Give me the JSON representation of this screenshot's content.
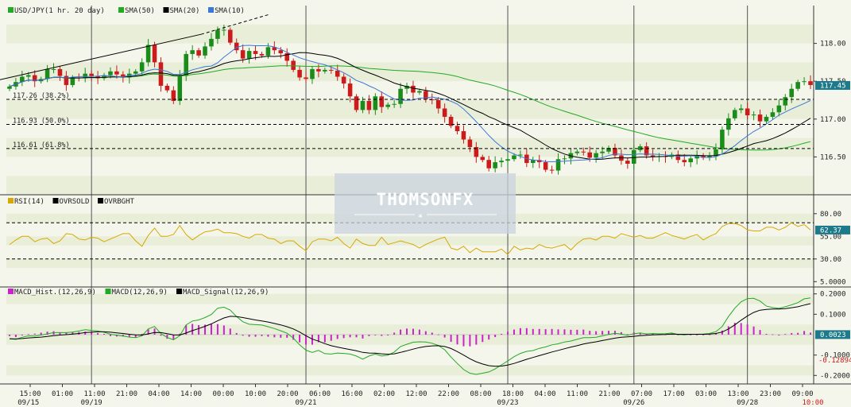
{
  "chart_data": [
    {
      "type": "candlestick",
      "panel": "price",
      "legend": [
        {
          "label": "USD/JPY(1 hr.  20 day)",
          "color": "#22aa22"
        },
        {
          "label": "SMA(50)",
          "color": "#22aa22"
        },
        {
          "label": "SMA(20)",
          "color": "#000000"
        },
        {
          "label": "SMA(10)",
          "color": "#3a78d8"
        }
      ],
      "y_ticks": [
        "118.00",
        "117.50",
        "117.00",
        "116.50"
      ],
      "ylim": [
        116.0,
        118.5
      ],
      "last_price": "117.45",
      "fib_levels": [
        {
          "label": "117.26 (38.2%)",
          "value": 117.26
        },
        {
          "label": "116.93 (50.0%)",
          "value": 116.93
        },
        {
          "label": "116.61 (61.8%)",
          "value": 116.61
        }
      ],
      "close_series": [
        117.43,
        117.49,
        117.56,
        117.58,
        117.5,
        117.53,
        117.66,
        117.66,
        117.57,
        117.45,
        117.55,
        117.54,
        117.6,
        117.57,
        117.54,
        117.58,
        117.63,
        117.59,
        117.55,
        117.6,
        117.63,
        117.75,
        117.98,
        117.75,
        117.44,
        117.38,
        117.24,
        117.57,
        117.86,
        117.91,
        117.84,
        117.96,
        118.06,
        118.18,
        118.18,
        118.01,
        117.91,
        117.8,
        117.9,
        117.86,
        117.84,
        117.95,
        117.91,
        117.87,
        117.77,
        117.65,
        117.55,
        117.53,
        117.66,
        117.63,
        117.65,
        117.64,
        117.56,
        117.47,
        117.3,
        117.12,
        117.24,
        117.12,
        117.3,
        117.16,
        117.19,
        117.2,
        117.4,
        117.44,
        117.35,
        117.37,
        117.26,
        117.25,
        117.14,
        117.03,
        116.91,
        116.84,
        116.73,
        116.63,
        116.5,
        116.46,
        116.35,
        116.43,
        116.45,
        116.47,
        116.52,
        116.53,
        116.42,
        116.46,
        116.43,
        116.33,
        116.32,
        116.47,
        116.48,
        116.55,
        116.57,
        116.56,
        116.49,
        116.55,
        116.57,
        116.62,
        116.52,
        116.45,
        116.41,
        116.59,
        116.64,
        116.52,
        116.5,
        116.51,
        116.5,
        116.53,
        116.46,
        116.43,
        116.48,
        116.52,
        116.49,
        116.51,
        116.6,
        116.86,
        117.01,
        117.12,
        117.14,
        117.05,
        117.06,
        116.97,
        117.03,
        117.09,
        117.18,
        117.29,
        117.4,
        117.49,
        117.5,
        117.45
      ],
      "x_ticks": [
        "15:00",
        "01:00",
        "11:00",
        "21:00",
        "04:00",
        "14:00",
        "00:00",
        "10:00",
        "20:00",
        "06:00",
        "16:00",
        "02:00",
        "12:00",
        "22:00",
        "08:00",
        "18:00",
        "04:00",
        "11:00",
        "21:00",
        "07:00",
        "17:00",
        "03:00",
        "13:00",
        "23:00",
        "09:00"
      ],
      "x_tick_dates": [
        "09/15",
        "",
        "",
        "",
        "",
        "",
        "09/19",
        "",
        "",
        "",
        "",
        "09/21",
        "",
        "",
        "",
        "",
        "09/23",
        "",
        "09/26",
        "",
        "",
        "",
        "",
        "09/28",
        ""
      ],
      "session_markers": [
        "09/15",
        "09/19",
        "09/21",
        "09/23",
        "09/26",
        "09/28"
      ]
    },
    {
      "type": "line",
      "panel": "rsi",
      "legend": [
        {
          "label": "RSI(14)",
          "color": "#d8a800"
        },
        {
          "label": "OVRSOLD",
          "color": "#000000"
        },
        {
          "label": "OVRBGHT",
          "color": "#000000"
        }
      ],
      "y_ticks": [
        "80.00",
        "30.00",
        "5.0000"
      ],
      "ylim": [
        0,
        100
      ],
      "overbought": 70,
      "oversold": 30,
      "last_value": "62.37",
      "behind_label": "55.00",
      "values": [
        46,
        51,
        55,
        55,
        49,
        52,
        53,
        47,
        50,
        58,
        57,
        52,
        51,
        54,
        53,
        49,
        52,
        55,
        58,
        58,
        50,
        44,
        56,
        64,
        55,
        55,
        57,
        67,
        57,
        51,
        56,
        60,
        61,
        63,
        59,
        59,
        58,
        55,
        53,
        57,
        57,
        53,
        52,
        47,
        50,
        50,
        44,
        39,
        49,
        52,
        52,
        50,
        54,
        47,
        42,
        52,
        47,
        45,
        45,
        54,
        46,
        48,
        50,
        48,
        46,
        42,
        46,
        49,
        52,
        54,
        42,
        40,
        44,
        37,
        42,
        38,
        38,
        38,
        41,
        35,
        44,
        40,
        42,
        41,
        46,
        43,
        42,
        44,
        46,
        40,
        47,
        52,
        53,
        51,
        55,
        55,
        53,
        58,
        56,
        54,
        56,
        53,
        53,
        56,
        59,
        56,
        54,
        52,
        55,
        57,
        51,
        55,
        58,
        66,
        69,
        69,
        67,
        62,
        61,
        61,
        65,
        65,
        62,
        65,
        70,
        66,
        68,
        62
      ]
    },
    {
      "type": "bar+line",
      "panel": "macd",
      "legend": [
        {
          "label": "MACD_Hist.(12,26,9)",
          "color": "#cc22cc"
        },
        {
          "label": "MACD(12,26,9)",
          "color": "#22aa22"
        },
        {
          "label": "MACD_Signal(12,26,9)",
          "color": "#000000"
        }
      ],
      "y_ticks": [
        "0.2000",
        "0.1000",
        "-0.1000",
        "-0.2000"
      ],
      "ylim": [
        -0.23,
        0.23
      ],
      "last_value": "0.0023",
      "low_label": "-0.12894",
      "macd": [
        -0.02,
        -0.023,
        -0.013,
        -0.006,
        -0.007,
        -0.002,
        0.004,
        0.01,
        0.01,
        0.01,
        0.013,
        0.018,
        0.024,
        0.021,
        0.018,
        0.012,
        0.002,
        -0.003,
        -0.007,
        -0.012,
        -0.015,
        -0.006,
        0.028,
        0.04,
        0.005,
        -0.014,
        -0.025,
        -0.005,
        0.048,
        0.067,
        0.072,
        0.084,
        0.099,
        0.13,
        0.135,
        0.12,
        0.089,
        0.063,
        0.051,
        0.049,
        0.047,
        0.039,
        0.03,
        0.019,
        0.007,
        -0.017,
        -0.05,
        -0.076,
        -0.087,
        -0.077,
        -0.093,
        -0.095,
        -0.09,
        -0.092,
        -0.095,
        -0.105,
        -0.12,
        -0.105,
        -0.095,
        -0.105,
        -0.101,
        -0.085,
        -0.058,
        -0.047,
        -0.037,
        -0.035,
        -0.036,
        -0.042,
        -0.053,
        -0.074,
        -0.11,
        -0.141,
        -0.171,
        -0.189,
        -0.195,
        -0.189,
        -0.183,
        -0.168,
        -0.148,
        -0.129,
        -0.108,
        -0.092,
        -0.082,
        -0.078,
        -0.067,
        -0.06,
        -0.05,
        -0.045,
        -0.036,
        -0.031,
        -0.023,
        -0.015,
        -0.015,
        -0.013,
        -0.006,
        0.001,
        0.007,
        0.003,
        -0.003,
        0.005,
        0.008,
        0.004,
        0.006,
        0.004,
        0.005,
        0.008,
        0.001,
        -0.001,
        0.002,
        0.002,
        0.003,
        0.006,
        0.015,
        0.04,
        0.089,
        0.13,
        0.161,
        0.177,
        0.178,
        0.165,
        0.14,
        0.133,
        0.129,
        0.137,
        0.146,
        0.157,
        0.176,
        0.18
      ],
      "signal": [
        -0.02,
        -0.021,
        -0.019,
        -0.016,
        -0.014,
        -0.012,
        -0.009,
        -0.005,
        -0.002,
        0.0,
        0.003,
        0.006,
        0.01,
        0.012,
        0.014,
        0.014,
        0.012,
        0.009,
        0.006,
        0.002,
        -0.001,
        -0.002,
        0.004,
        0.011,
        0.01,
        0.005,
        -0.001,
        -0.002,
        0.008,
        0.02,
        0.03,
        0.041,
        0.053,
        0.068,
        0.082,
        0.09,
        0.089,
        0.084,
        0.078,
        0.072,
        0.067,
        0.062,
        0.055,
        0.048,
        0.039,
        0.028,
        0.013,
        -0.005,
        -0.022,
        -0.032,
        -0.044,
        -0.054,
        -0.061,
        -0.067,
        -0.073,
        -0.079,
        -0.087,
        -0.09,
        -0.091,
        -0.094,
        -0.096,
        -0.094,
        -0.087,
        -0.079,
        -0.071,
        -0.063,
        -0.058,
        -0.055,
        -0.054,
        -0.058,
        -0.068,
        -0.083,
        -0.1,
        -0.118,
        -0.133,
        -0.144,
        -0.152,
        -0.155,
        -0.154,
        -0.149,
        -0.141,
        -0.131,
        -0.121,
        -0.112,
        -0.103,
        -0.094,
        -0.085,
        -0.077,
        -0.069,
        -0.061,
        -0.054,
        -0.046,
        -0.04,
        -0.035,
        -0.029,
        -0.023,
        -0.017,
        -0.013,
        -0.011,
        -0.008,
        -0.005,
        -0.003,
        -0.001,
        0.0,
        0.001,
        0.003,
        0.002,
        0.002,
        0.002,
        0.002,
        0.002,
        0.003,
        0.006,
        0.013,
        0.028,
        0.048,
        0.071,
        0.092,
        0.109,
        0.12,
        0.124,
        0.126,
        0.126,
        0.128,
        0.132,
        0.137,
        0.145,
        0.152
      ],
      "hist": [
        -0.007,
        -0.012,
        -0.004,
        0.003,
        0.005,
        0.01,
        0.015,
        0.017,
        0.012,
        0.011,
        0.012,
        0.013,
        0.015,
        0.012,
        0.008,
        0.004,
        -0.007,
        -0.009,
        -0.009,
        -0.012,
        -0.014,
        0.004,
        0.026,
        0.03,
        -0.005,
        -0.02,
        -0.023,
        0.005,
        0.046,
        0.053,
        0.047,
        0.049,
        0.052,
        0.052,
        0.045,
        0.03,
        0.008,
        -0.005,
        -0.01,
        -0.01,
        -0.007,
        -0.01,
        -0.013,
        -0.015,
        -0.015,
        -0.025,
        -0.038,
        -0.048,
        -0.049,
        -0.037,
        -0.038,
        -0.03,
        -0.021,
        -0.017,
        -0.013,
        -0.013,
        -0.019,
        -0.007,
        0.0,
        -0.006,
        -0.004,
        0.01,
        0.025,
        0.03,
        0.029,
        0.025,
        0.017,
        0.01,
        0.001,
        -0.014,
        -0.035,
        -0.048,
        -0.057,
        -0.057,
        -0.049,
        -0.036,
        -0.024,
        -0.012,
        0.004,
        0.015,
        0.025,
        0.032,
        0.032,
        0.028,
        0.028,
        0.027,
        0.028,
        0.026,
        0.026,
        0.024,
        0.024,
        0.025,
        0.019,
        0.017,
        0.018,
        0.019,
        0.019,
        0.012,
        0.002,
        0.011,
        0.01,
        0.004,
        0.004,
        0.001,
        0.001,
        0.004,
        -0.002,
        -0.003,
        0.0,
        -0.001,
        0.0,
        0.001,
        0.007,
        0.02,
        0.041,
        0.058,
        0.057,
        0.05,
        0.04,
        0.023,
        0.004,
        0.002,
        -0.004,
        0.003,
        0.008,
        0.009,
        0.018,
        0.01
      ]
    }
  ],
  "watermark": "THOMSONFX",
  "time_label": "10:00"
}
